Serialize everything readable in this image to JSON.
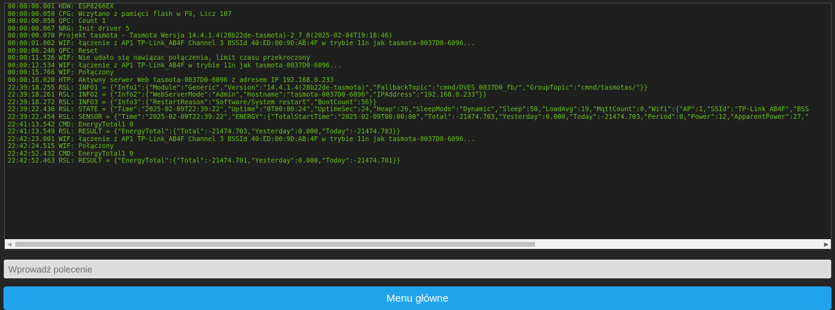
{
  "console": {
    "lines": [
      "00:00:00.001 HDW: ESP8266EX",
      "00:00:00.050 CFG: Wczytano z pamięci flash w F9, Licz 107",
      "00:00:00.056 QPC: Count 1",
      "00:00:00.067 NRG: Init driver 5",
      "00:00:00.070 Projekt tasmota - Tasmota Wersja 14.4.1.4(28b22de-tasmota)-2_7_8(2025-02-04T19:18:46)",
      "00:00:01.002 WIF: łączenie z AP1 TP-Link_AB4F Channel 3 BSSId 40:ED:00:9D:AB:4F w trybie 11n jak tasmota-0037D0-6096...",
      "00:00:06.246 QPC: Reset",
      "00:00:11.526 WIF: Nie udało się nawiązac połączenia, limit czasu przekroczony",
      "00:00:12.534 WIF: łączenie z AP1 TP-Link_AB4F w trybie 11n jak tasmota-0037D0-6096...",
      "00:00:15.766 WIF: Połączony",
      "00:00:16.020 HTP: Aktywny serwer Web tasmota-0037D0-6096 z adresem IP 192.168.0.233",
      "22:39:18.255 RSL: INFO1 = {\"Info1\":{\"Module\":\"Generic\",\"Version\":\"14.4.1.4(28b22de-tasmota)\",\"FallbackTopic\":\"cmnd/DVES_0037D0_fb/\",\"GroupTopic\":\"cmnd/tasmotas/\"}}",
      "22:39:18.261 RSL: INFO2 = {\"Info2\":{\"WebServerMode\":\"Admin\",\"Hostname\":\"tasmota-0037D0-6096\",\"IPAddress\":\"192.168.0.233\"}}",
      "22:39:18.272 RSL: INFO3 = {\"Info3\":{\"RestartReason\":\"Software/System restart\",\"BootCount\":56}}",
      "22:39:22.430 RSL: STATE = {\"Time\":\"2025-02-09T22:39:22\",\"Uptime\":\"0T00:00:24\",\"UptimeSec\":24,\"Heap\":26,\"SleepMode\":\"Dynamic\",\"Sleep\":50,\"LoadAvg\":19,\"MqttCount\":0,\"Wifi\":{\"AP\":1,\"SSId\":\"TP-Link_AB4F\",\"BSS",
      "22:39:22.454 RSL: SENSOR = {\"Time\":\"2025-02-09T22:39:22\",\"ENERGY\":{\"TotalStartTime\":\"2025-02-09T00:00:00\",\"Total\":-21474.703,\"Yesterday\":0.000,\"Today\":-21474.703,\"Period\":0,\"Power\":12,\"ApparentPower\":27,\"",
      "22:41:13.542 CMD: EnergyTotal1 0",
      "22:41:13.549 RSL: RESULT = {\"EnergyTotal\":{\"Total\":-21474.703,\"Yesterday\":0.000,\"Today\":-21474.703}}",
      "22:42:23.001 WIF: łączenie z AP1 TP-Link_AB4F Channel 3 BSSId 40:ED:00:9D:AB:4F w trybie 11n jak tasmota-0037D0-6096...",
      "22:42:24.515 WIF: Połączony",
      "22:42:52.432 CMD: EnergyTotal1 0",
      "22:42:52.463 RSL: RESULT = {\"EnergyTotal\":{\"Total\":-21474.701,\"Yesterday\":0.000,\"Today\":-21474.701}}"
    ],
    "scroll_left_icon": "◀",
    "scroll_right_icon": "▶"
  },
  "command": {
    "placeholder": "Wprowadź polecenie",
    "value": ""
  },
  "menu": {
    "main_button_label": "Menu główne"
  },
  "colors": {
    "background": "#252525",
    "console_background": "#1f1f1f",
    "console_text": "#65c115",
    "button": "#1fa3ec",
    "button_text": "#ffffff"
  }
}
